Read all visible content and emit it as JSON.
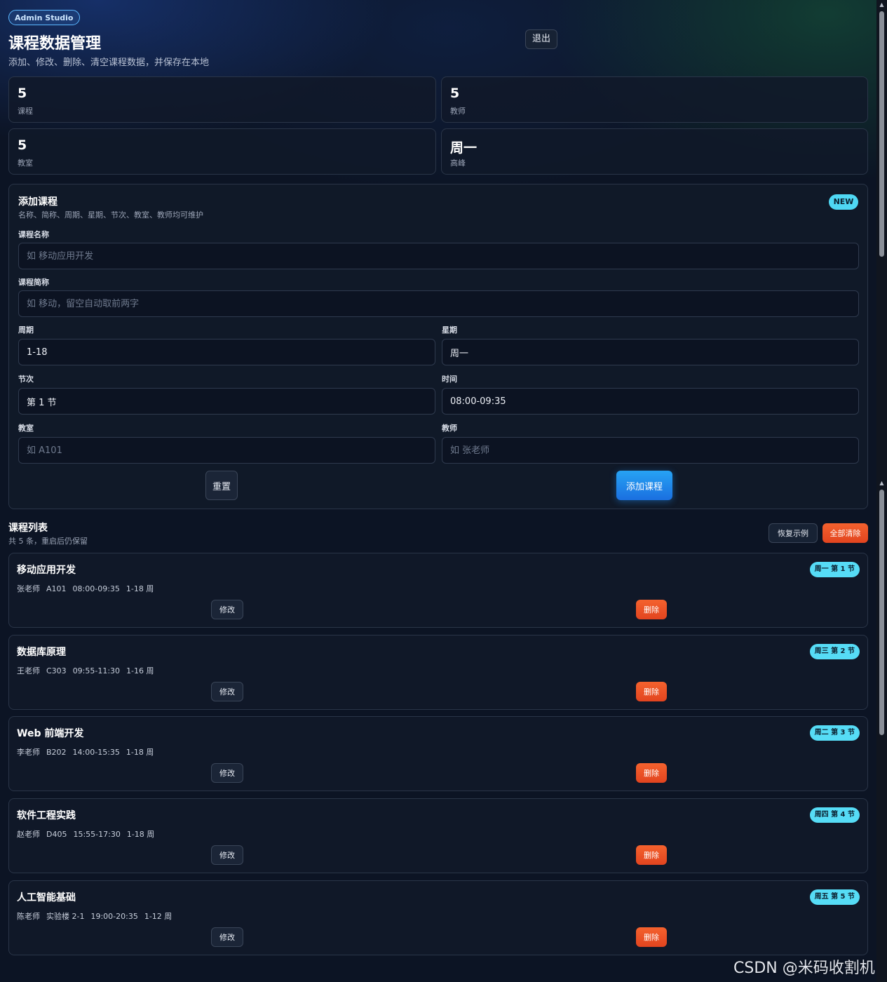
{
  "header": {
    "brand": "Admin Studio",
    "title": "课程数据管理",
    "subtitle": "添加、修改、删除、清空课程数据，并保存在本地",
    "logout_label": "退出"
  },
  "stats": [
    {
      "value": "5",
      "label": "课程"
    },
    {
      "value": "5",
      "label": "教师"
    },
    {
      "value": "5",
      "label": "教室"
    },
    {
      "value": "周一",
      "label": "高峰"
    }
  ],
  "form": {
    "title": "添加课程",
    "subtitle": "名称、简称、周期、星期、节次、教室、教师均可维护",
    "badge": "NEW",
    "fields": {
      "name": {
        "label": "课程名称",
        "value": "",
        "placeholder": "如 移动应用开发"
      },
      "short": {
        "label": "课程简称",
        "value": "",
        "placeholder": "如 移动，留空自动取前两字"
      },
      "weeks": {
        "label": "周期",
        "value": "1-18",
        "placeholder": ""
      },
      "weekday": {
        "label": "星期",
        "value": "周一",
        "placeholder": ""
      },
      "period": {
        "label": "节次",
        "value": "第 1 节",
        "placeholder": ""
      },
      "time": {
        "label": "时间",
        "value": "08:00-09:35",
        "placeholder": ""
      },
      "room": {
        "label": "教室",
        "value": "",
        "placeholder": "如 A101"
      },
      "teacher": {
        "label": "教师",
        "value": "",
        "placeholder": "如 张老师"
      }
    },
    "reset_label": "重置",
    "submit_label": "添加课程"
  },
  "list": {
    "title": "课程列表",
    "subtitle": "共 5 条，重启后仍保留",
    "restore_label": "恢复示例",
    "clear_label": "全部清除",
    "edit_label": "修改",
    "delete_label": "删除",
    "courses": [
      {
        "name": "移动应用开发",
        "badge": "周一 第 1 节",
        "teacher": "张老师",
        "room": "A101",
        "time": "08:00-09:35",
        "weeks": "1-18 周"
      },
      {
        "name": "数据库原理",
        "badge": "周三 第 2 节",
        "teacher": "王老师",
        "room": "C303",
        "time": "09:55-11:30",
        "weeks": "1-16 周"
      },
      {
        "name": "Web 前端开发",
        "badge": "周二 第 3 节",
        "teacher": "李老师",
        "room": "B202",
        "time": "14:00-15:35",
        "weeks": "1-18 周"
      },
      {
        "name": "软件工程实践",
        "badge": "周四 第 4 节",
        "teacher": "赵老师",
        "room": "D405",
        "time": "15:55-17:30",
        "weeks": "1-18 周"
      },
      {
        "name": "人工智能基础",
        "badge": "周五 第 5 节",
        "teacher": "陈老师",
        "room": "实验楼 2-1",
        "time": "19:00-20:35",
        "weeks": "1-12 周"
      }
    ]
  },
  "watermark": "CSDN @米码收割机",
  "icons": {
    "scroll_up": "triangle-up-icon",
    "scroll_down": "triangle-down-icon"
  }
}
